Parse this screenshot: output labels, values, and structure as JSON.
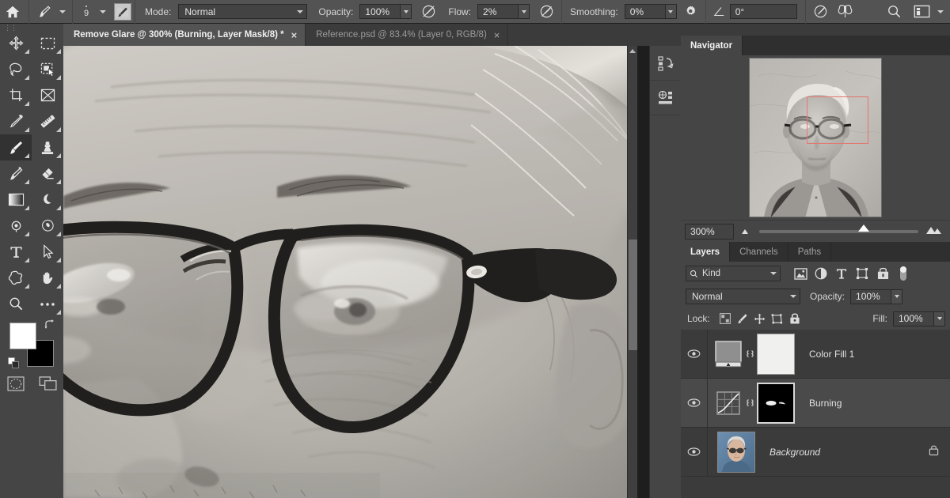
{
  "app": {
    "title": "Adobe Photoshop",
    "accent_red": "#e4786f",
    "panel_bg": "#454545",
    "chrome_bg": "#535353"
  },
  "options_bar": {
    "home_icon": "home-icon",
    "brush_tool_icon": "brush-icon",
    "brush_size": "9",
    "brush_preset_icon": "brush-preset-icon",
    "mode_label": "Mode:",
    "mode_value": "Normal",
    "opacity_label": "Opacity:",
    "opacity_value": "100%",
    "pressure_opacity_icon": "pressure-opacity-icon",
    "flow_label": "Flow:",
    "flow_value": "2%",
    "airbrush_icon": "airbrush-icon",
    "smoothing_label": "Smoothing:",
    "smoothing_value": "0%",
    "smoothing_options_icon": "gear-icon",
    "angle_icon": "angle-icon",
    "angle_value": "0°",
    "pressure_size_icon": "pressure-size-icon",
    "symmetry_icon": "symmetry-butterfly-icon",
    "search_icon": "search-icon",
    "workspace_icon": "workspace-switcher-icon",
    "workspace_chevron_icon": "chevron-down-icon"
  },
  "tabs": [
    {
      "label": "Remove Glare @ 300% (Burning, Layer Mask/8) *",
      "close": "×",
      "active": true
    },
    {
      "label": "Reference.psd @ 83.4% (Layer 0, RGB/8)",
      "close": "×",
      "active": false
    }
  ],
  "toolbar": {
    "grip": "⋮⋮",
    "tools": [
      {
        "name": "move-tool",
        "icon": "move-icon",
        "selected": false,
        "has_flyout": true
      },
      {
        "name": "rectangular-marquee-tool",
        "icon": "marquee-icon",
        "selected": false,
        "has_flyout": true
      },
      {
        "name": "lasso-tool",
        "icon": "lasso-icon",
        "selected": false,
        "has_flyout": true
      },
      {
        "name": "object-selection-tool",
        "icon": "object-select-icon",
        "selected": false,
        "has_flyout": true
      },
      {
        "name": "crop-tool",
        "icon": "crop-icon",
        "selected": false,
        "has_flyout": true
      },
      {
        "name": "frame-tool",
        "icon": "frame-icon",
        "selected": false,
        "has_flyout": false
      },
      {
        "name": "eyedropper-tool",
        "icon": "eyedropper-icon",
        "selected": false,
        "has_flyout": true
      },
      {
        "name": "ruler-tool",
        "icon": "ruler-icon",
        "selected": false,
        "has_flyout": true
      },
      {
        "name": "brush-tool",
        "icon": "brush-icon",
        "selected": true,
        "has_flyout": true
      },
      {
        "name": "clone-stamp-tool",
        "icon": "stamp-icon",
        "selected": false,
        "has_flyout": true
      },
      {
        "name": "healing-brush-tool",
        "icon": "healing-brush-icon",
        "selected": false,
        "has_flyout": true
      },
      {
        "name": "eraser-tool",
        "icon": "eraser-icon",
        "selected": false,
        "has_flyout": true
      },
      {
        "name": "gradient-tool",
        "icon": "gradient-icon",
        "selected": false,
        "has_flyout": true
      },
      {
        "name": "dodge-burn-tool",
        "icon": "dodge-burn-icon",
        "selected": false,
        "has_flyout": true
      },
      {
        "name": "blur-tool",
        "icon": "blur-drop-icon",
        "selected": false,
        "has_flyout": true
      },
      {
        "name": "pen-tool",
        "icon": "pen-icon",
        "selected": false,
        "has_flyout": true
      },
      {
        "name": "type-tool",
        "icon": "type-t-icon",
        "selected": false,
        "has_flyout": true
      },
      {
        "name": "path-selection-tool",
        "icon": "path-arrow-icon",
        "selected": false,
        "has_flyout": true
      },
      {
        "name": "shape-tool",
        "icon": "custom-shape-icon",
        "selected": false,
        "has_flyout": true
      },
      {
        "name": "hand-tool",
        "icon": "hand-icon",
        "selected": false,
        "has_flyout": true
      },
      {
        "name": "zoom-tool",
        "icon": "magnifier-icon",
        "selected": false,
        "has_flyout": false
      },
      {
        "name": "edit-toolbar",
        "icon": "ellipsis-icon",
        "selected": false,
        "has_flyout": true
      }
    ],
    "foreground_color": "#ffffff",
    "background_color": "#000000",
    "swap_icon": "swap-colors-icon",
    "default_colors_icon": "default-colors-icon",
    "quick_mask_icon": "quick-mask-icon",
    "screen_mode_icon": "screen-mode-icon"
  },
  "dock_strip": {
    "buttons": [
      {
        "name": "history-panel-button",
        "icon": "history-icon"
      },
      {
        "name": "properties-panel-button",
        "icon": "properties-icon"
      }
    ]
  },
  "navigator": {
    "tab_label": "Navigator",
    "zoom_value": "300%",
    "zoom_out_icon": "small-mountain-icon",
    "zoom_in_icon": "large-mountain-icon",
    "slider_position_pct": 62,
    "viewbox_color": "#e4786f",
    "thumbnail_alt": "grayscale-portrait-of-older-man-with-glasses"
  },
  "layers_panel": {
    "tabs": [
      {
        "label": "Layers",
        "active": true
      },
      {
        "label": "Channels",
        "active": false
      },
      {
        "label": "Paths",
        "active": false
      }
    ],
    "filter": {
      "search_icon": "search-icon",
      "kind_label": "Kind",
      "chevron_icon": "chevron-down-icon",
      "icons": [
        {
          "name": "filter-pixel-icon",
          "icon": "image-icon"
        },
        {
          "name": "filter-adjustment-icon",
          "icon": "half-circle-icon"
        },
        {
          "name": "filter-type-icon",
          "icon": "type-t-icon"
        },
        {
          "name": "filter-shape-icon",
          "icon": "shape-bounds-icon"
        },
        {
          "name": "filter-smart-object-icon",
          "icon": "smart-object-icon"
        },
        {
          "name": "filter-toggle",
          "icon": "toggle-switch-icon"
        }
      ]
    },
    "blend_mode": "Normal",
    "opacity_label": "Opacity:",
    "opacity_value": "100%",
    "lock_label": "Lock:",
    "lock_icons": [
      {
        "name": "lock-transparent-pixels",
        "icon": "checkerboard-icon"
      },
      {
        "name": "lock-image-pixels",
        "icon": "brush-icon"
      },
      {
        "name": "lock-position",
        "icon": "move-icon"
      },
      {
        "name": "lock-artboard-nesting",
        "icon": "artboard-icon"
      },
      {
        "name": "lock-all",
        "icon": "padlock-icon"
      }
    ],
    "fill_label": "Fill:",
    "fill_value": "100%",
    "layers": [
      {
        "name": "Color Fill 1",
        "visible": true,
        "selected": false,
        "italic": false,
        "thumb_type": "solid-color-adjustment",
        "has_mask": true,
        "mask_type": "white",
        "linked": true,
        "locked": false
      },
      {
        "name": "Burning",
        "visible": true,
        "selected": true,
        "italic": false,
        "thumb_type": "curves-adjustment",
        "has_mask": true,
        "mask_type": "black-with-white-strokes",
        "linked": true,
        "locked": false
      },
      {
        "name": "Background",
        "visible": true,
        "selected": false,
        "italic": true,
        "thumb_type": "photo",
        "has_mask": false,
        "linked": false,
        "locked": true
      }
    ]
  }
}
